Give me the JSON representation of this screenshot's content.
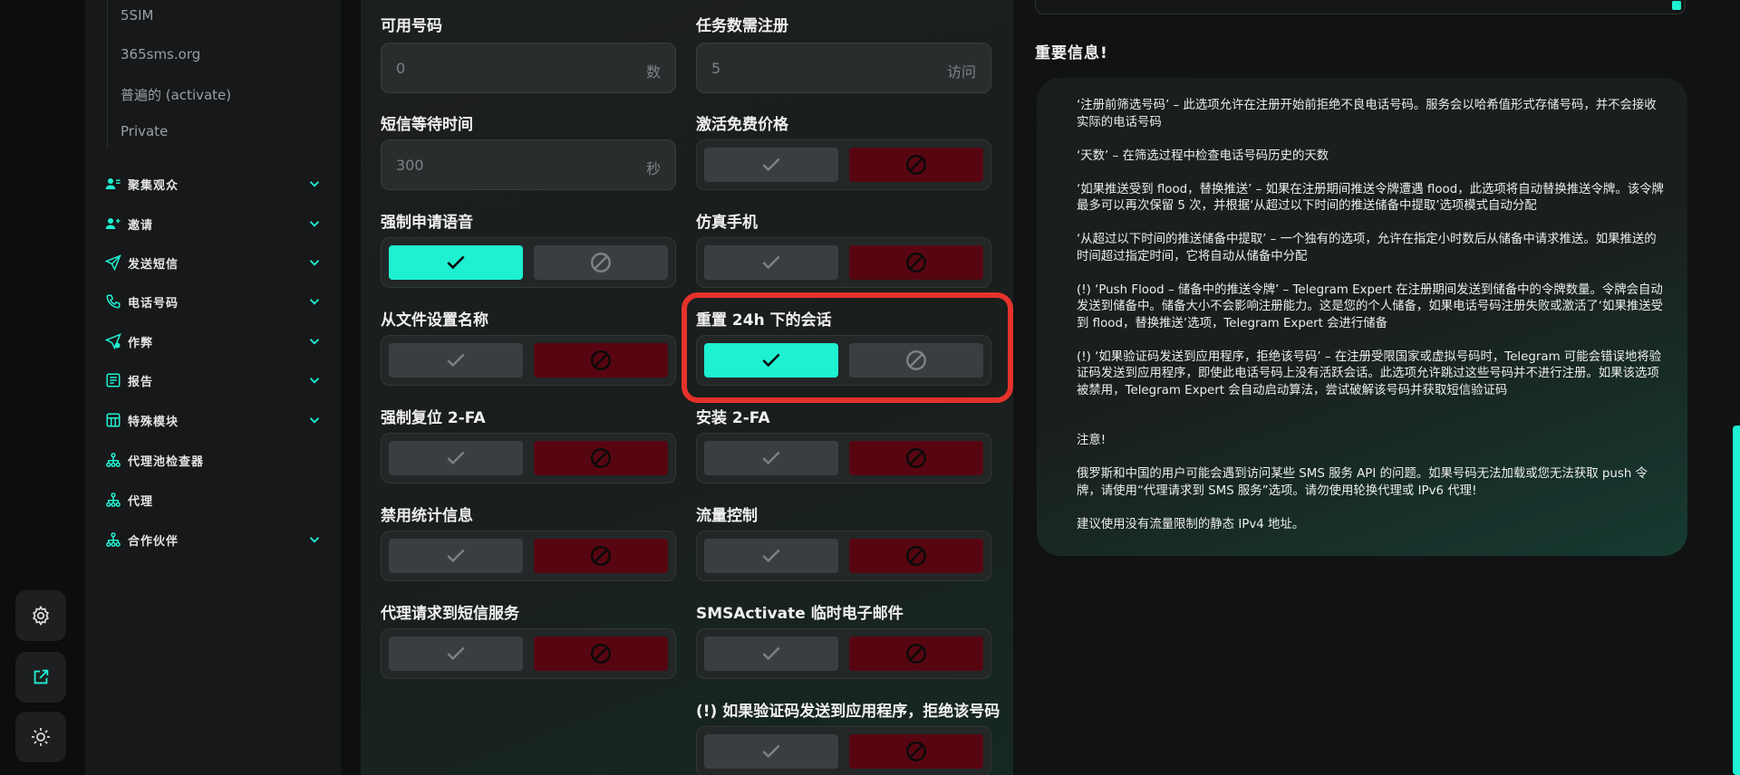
{
  "sidebar": {
    "sub_items": [
      "5SIM",
      "365sms.org",
      "普遍的 (activate)",
      "Private"
    ],
    "items": [
      {
        "label": "聚集观众",
        "icon": "users-icon",
        "has_chevron": true
      },
      {
        "label": "邀请",
        "icon": "user-plus-icon",
        "has_chevron": true
      },
      {
        "label": "发送短信",
        "icon": "send-icon",
        "has_chevron": true
      },
      {
        "label": "电话号码",
        "icon": "phone-icon",
        "has_chevron": true
      },
      {
        "label": "作弊",
        "icon": "send-gear-icon",
        "has_chevron": true
      },
      {
        "label": "报告",
        "icon": "report-icon",
        "has_chevron": true
      },
      {
        "label": "特殊模块",
        "icon": "module-icon",
        "has_chevron": true
      },
      {
        "label": "代理池检查器",
        "icon": "network-icon",
        "has_chevron": false
      },
      {
        "label": "代理",
        "icon": "network-icon",
        "has_chevron": false
      },
      {
        "label": "合作伙伴",
        "icon": "network-icon",
        "has_chevron": true
      }
    ]
  },
  "rail": {
    "buttons": [
      "gear-icon",
      "external-link-icon",
      "sun-icon"
    ]
  },
  "form": {
    "fields": {
      "available_numbers": {
        "label": "可用号码",
        "value": "0",
        "unit": "数"
      },
      "task_registrations": {
        "label": "任务数需注册",
        "value": "5",
        "unit": "访问"
      },
      "sms_wait": {
        "label": "短信等待时间",
        "value": "300",
        "unit": "秒"
      }
    },
    "toggles": {
      "activation_free_price": {
        "label": "激活免费价格",
        "on": false
      },
      "force_voice": {
        "label": "强制申请语音",
        "on": true
      },
      "emulate_phone": {
        "label": "仿真手机",
        "on": false
      },
      "name_from_file": {
        "label": "从文件设置名称",
        "on": false
      },
      "reset_sessions_24h": {
        "label": "重置 24h 下的会话",
        "on": true
      },
      "force_reset_2fa": {
        "label": "强制复位 2-FA",
        "on": false
      },
      "install_2fa": {
        "label": "安装 2-FA",
        "on": false
      },
      "disable_stats": {
        "label": "禁用统计信息",
        "on": false
      },
      "traffic_control": {
        "label": "流量控制",
        "on": false
      },
      "proxy_to_sms": {
        "label": "代理请求到短信服务",
        "on": false
      },
      "smsactivate_temp_email": {
        "label": "SMSActivate 临时电子邮件",
        "on": false
      },
      "reject_if_app_code": {
        "label": "(!) 如果验证码发送到应用程序，拒绝该号码",
        "on": false
      }
    }
  },
  "info": {
    "title": "重要信息!",
    "text": "‘注册前筛选号码’ – 此选项允许在注册开始前拒绝不良电话号码。服务会以哈希值形式存储号码，并不会接收实际的电话号码\n\n‘天数’ – 在筛选过程中检查电话号码历史的天数\n\n‘如果推送受到 flood，替换推送’ – 如果在注册期间推送令牌遭遇 flood，此选项将自动替换推送令牌。该令牌最多可以再次保留 5 次，并根据‘从超过以下时间的推送储备中提取’选项模式自动分配\n\n‘从超过以下时间的推送储备中提取’ – 一个独有的选项，允许在指定小时数后从储备中请求推送。如果推送的时间超过指定时间，它将自动从储备中分配\n\n(!) ‘Push Flood – 储备中的推送令牌’ – Telegram Expert 在注册期间发送到储备中的令牌数量。令牌会自动发送到储备中。储备大小不会影响注册能力。这是您的个人储备，如果电话号码注册失败或激活了‘如果推送受到 flood，替换推送’选项，Telegram Expert 会进行储备\n\n(!) ‘如果验证码发送到应用程序，拒绝该号码’ – 在注册受限国家或虚拟号码时，Telegram 可能会错误地将验证码发送到应用程序，即使此电话号码上没有活跃会话。此选项允许跳过这些号码并不进行注册。如果该选项被禁用，Telegram Expert 会自动启动算法，尝试破解该号码并获取短信验证码\n\n\n注意!\n\n俄罗斯和中国的用户可能会遇到访问某些 SMS 服务 API 的问题。如果号码无法加载或您无法获取 push 令牌，请使用“代理请求到 SMS 服务”选项。请勿使用轮换代理或 IPv6 代理!\n\n建议使用没有流量限制的静态 IPv4 地址。"
  },
  "colors": {
    "accent": "#1ef0d2",
    "reject": "#570611",
    "highlight": "#e5322b"
  }
}
